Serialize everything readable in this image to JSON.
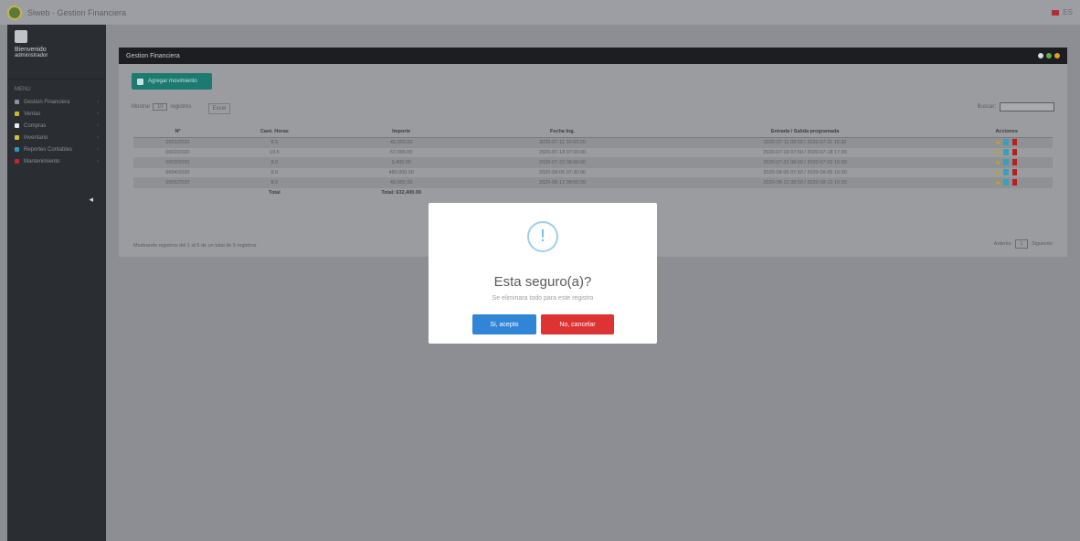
{
  "topbar": {
    "title": "Siweb - Gestion Financiera",
    "lang": "ES"
  },
  "sidebar": {
    "profile_name": "Bienvenido",
    "profile_role": "administrador",
    "menu_header": "MENU",
    "items": [
      {
        "label": "Gestion Financiera",
        "color": "#8a9096"
      },
      {
        "label": "Ventas",
        "color": "#c8b430"
      },
      {
        "label": "Compras",
        "color": "#e8ecf0"
      },
      {
        "label": "Inventario",
        "color": "#d0c040"
      },
      {
        "label": "Reportes Contables",
        "color": "#2a9ac0"
      },
      {
        "label": "Mantenimiento",
        "color": "#c02828"
      }
    ]
  },
  "panel": {
    "title": "Gestion Financiera",
    "add_label": "Agregar movimiento",
    "show_label": "Mostrar",
    "entries_value": "10",
    "entries_label": "registros",
    "export_label": "Excel",
    "search_label": "Buscar:",
    "columns": [
      "Nº",
      "Cant. Horas",
      "Importe",
      "Fecha Ing.",
      "Entrada / Salida programada",
      "Acciones"
    ],
    "rows": [
      [
        "0001/2020",
        "8.5",
        "48,000.00",
        "2020-07-11 10:00:00",
        "2020-07-11 08:00 / 2020-07-11 16:30",
        ""
      ],
      [
        "0002/2020",
        "10.5",
        "57,000.00",
        "2020-07-18 07:00:00",
        "2020-07-18 07:00 / 2020-07-18 17:30",
        ""
      ],
      [
        "0003/2020",
        "8.0",
        "3,400.00",
        "2020-07-22 08:00:00",
        "2020-07-22 08:00 / 2020-07-22 16:00",
        ""
      ],
      [
        "0004/2020",
        "9.0",
        "480,000.00",
        "2020-08-05 07:30:00",
        "2020-08-05 07:30 / 2020-08-05 16:30",
        ""
      ],
      [
        "0005/2020",
        "8.5",
        "48,000.00",
        "2020-08-12 08:00:00",
        "2020-08-12 08:00 / 2020-08-12 16:30",
        ""
      ]
    ],
    "footer_label": "Total",
    "footer_total": "Total: 632,400.00",
    "info": "Mostrando registros del 1 al 5 de un total de 5 registros",
    "prev_label": "Anterior",
    "page": "1",
    "next_label": "Siguiente"
  },
  "modal": {
    "icon": "info-icon",
    "title": "Esta seguro(a)?",
    "text": "Se eliminara todo para este registro",
    "confirm_label": "Si, acepto",
    "cancel_label": "No, cancelar",
    "confirm_color": "#3085d6",
    "cancel_color": "#dd3333"
  }
}
